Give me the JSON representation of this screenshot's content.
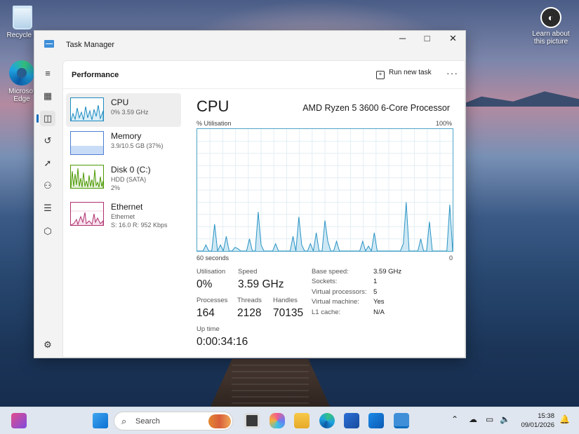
{
  "desktop": {
    "icons": [
      {
        "label": "Recycle B"
      },
      {
        "label": "Microsof Edge"
      },
      {
        "label": "Learn about this picture"
      }
    ]
  },
  "window": {
    "title": "Task Manager",
    "controls": {
      "minimize": "─",
      "maximize": "□",
      "close": "✕"
    }
  },
  "nav": {
    "items": [
      {
        "icon": "hamburger-icon",
        "glyph": "≡"
      },
      {
        "icon": "processes-icon",
        "glyph": "▦"
      },
      {
        "icon": "performance-icon",
        "glyph": "◫",
        "active": true
      },
      {
        "icon": "app-history-icon",
        "glyph": "↺"
      },
      {
        "icon": "startup-apps-icon",
        "glyph": "➚"
      },
      {
        "icon": "users-icon",
        "glyph": "⚇"
      },
      {
        "icon": "details-icon",
        "glyph": "☰"
      },
      {
        "icon": "services-icon",
        "glyph": "⬡"
      },
      {
        "icon": "settings-icon",
        "glyph": "⚙"
      }
    ]
  },
  "header": {
    "page_title": "Performance",
    "run_new_task": "Run new task",
    "more": "···"
  },
  "devices": [
    {
      "name": "CPU",
      "sub1": "0% 3.59 GHz",
      "sub2": "",
      "color": "#1c8bc0",
      "fill": "#d9eef7"
    },
    {
      "name": "Memory",
      "sub1": "3.9/10.5 GB (37%)",
      "sub2": "",
      "color": "#4b7fd1",
      "fill": "#c9dcf7"
    },
    {
      "name": "Disk 0 (C:)",
      "sub1": "HDD (SATA)",
      "sub2": "2%",
      "color": "#4e9a06",
      "fill": "#e6f2dc"
    },
    {
      "name": "Ethernet",
      "sub1": "Ethernet",
      "sub2": "S: 16.0 R: 952 Kbps",
      "color": "#b0306f",
      "fill": "#f7e2ec"
    }
  ],
  "cpu": {
    "heading": "CPU",
    "model": "AMD Ryzen 5 3600 6-Core Processor",
    "graph_ylabel": "% Utilisation",
    "graph_ymax": "100%",
    "graph_xlabel": "60 seconds",
    "graph_xmin": "0",
    "utilisation_series": [
      0,
      0,
      0,
      5,
      0,
      0,
      22,
      0,
      5,
      0,
      12,
      0,
      0,
      3,
      2,
      0,
      0,
      0,
      10,
      0,
      0,
      32,
      5,
      0,
      0,
      0,
      0,
      6,
      0,
      0,
      0,
      0,
      0,
      12,
      0,
      28,
      5,
      0,
      0,
      6,
      0,
      15,
      0,
      0,
      25,
      8,
      0,
      0,
      8,
      0,
      0,
      0,
      0,
      0,
      0,
      0,
      0,
      8,
      0,
      4,
      0,
      15,
      0,
      0,
      0,
      0,
      0,
      0,
      0,
      0,
      0,
      6,
      40,
      0,
      0,
      0,
      0,
      10,
      0,
      0,
      24,
      0,
      0,
      0,
      0,
      0,
      0,
      38,
      0
    ],
    "stats": {
      "utilisation_label": "Utilisation",
      "utilisation": "0%",
      "speed_label": "Speed",
      "speed": "3.59 GHz",
      "processes_label": "Processes",
      "processes": "164",
      "threads_label": "Threads",
      "threads": "2128",
      "handles_label": "Handles",
      "handles": "70135",
      "uptime_label": "Up time",
      "uptime": "0:00:34:16"
    },
    "specs": [
      {
        "label": "Base speed:",
        "value": "3.59 GHz"
      },
      {
        "label": "Sockets:",
        "value": "1"
      },
      {
        "label": "Virtual processors:",
        "value": "5"
      },
      {
        "label": "Virtual machine:",
        "value": "Yes"
      },
      {
        "label": "L1 cache:",
        "value": "N/A"
      }
    ]
  },
  "taskbar": {
    "search_placeholder": "Search",
    "time": "15:38",
    "date": "09/01/2026"
  }
}
